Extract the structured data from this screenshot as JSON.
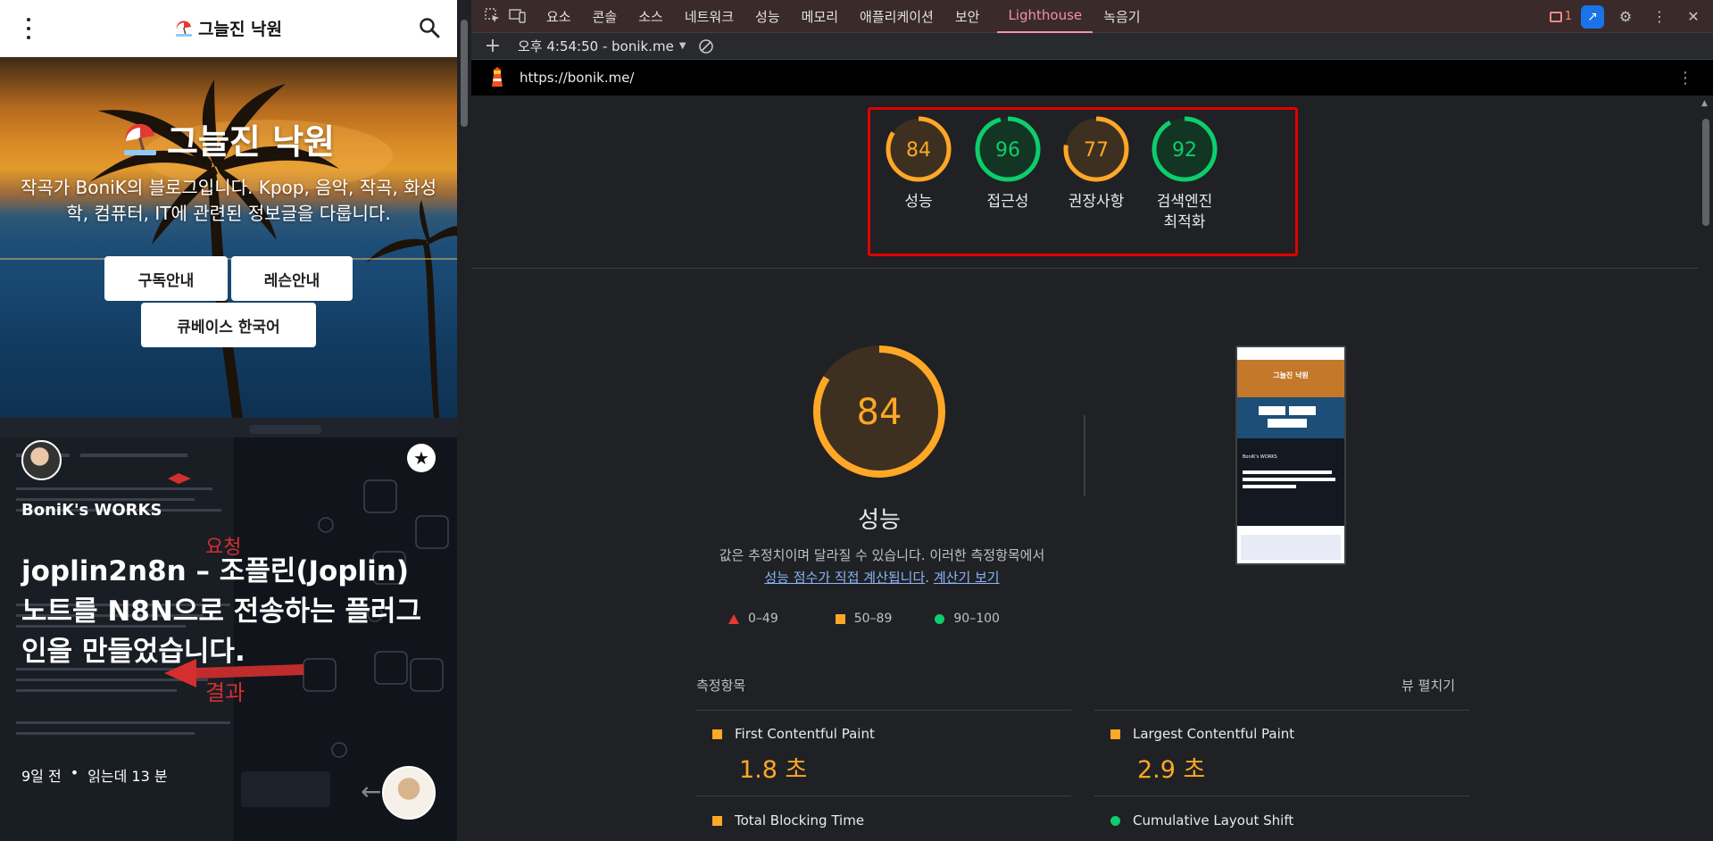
{
  "mobile": {
    "site_title": "그늘진 낙원",
    "hero_title": "그늘진 낙원",
    "hero_desc": "작곡가 BoniK의 블로그입니다. Kpop, 음악, 작곡, 화성학, 컴퓨터, IT에 관련된 정보글을 다룹니다.",
    "buttons": [
      "구독안내",
      "레슨안내",
      "큐베이스 한국어"
    ],
    "post": {
      "category": "BoniK's WORKS",
      "title": "joplin2n8n – 조플린(Joplin) 노트를 N8N으로 전송하는 플러그인을 만들었습니다.",
      "date": "9일 전",
      "separator": "•",
      "read_time": "읽는데 13 분",
      "overlay_words": [
        "요청",
        "결과"
      ]
    },
    "icons": [
      "menu-kebab-icon",
      "search-icon",
      "beach-umbrella-icon",
      "star-icon",
      "arrow-left-icon"
    ]
  },
  "devtools": {
    "tabs": [
      "요소",
      "콘솔",
      "소스",
      "네트워크",
      "성능",
      "메모리",
      "애플리케이션",
      "보안",
      "Lighthouse",
      "녹음기"
    ],
    "active_tab": "Lighthouse",
    "issues_count": "1",
    "report_selector": "오후 4:54:50 - bonik.me",
    "url": "https://bonik.me/",
    "accent": "#f48fb1"
  },
  "scores": [
    {
      "value": 84,
      "label": "성능",
      "color": "#ffa726",
      "bg": "#3d3020"
    },
    {
      "value": 96,
      "label": "접근성",
      "color": "#0cce6b",
      "bg": "#133524"
    },
    {
      "value": 77,
      "label": "권장사항",
      "color": "#ffa726",
      "bg": "#3d3020"
    },
    {
      "value": 92,
      "label": "검색엔진\n최적화",
      "color": "#0cce6b",
      "bg": "#133524"
    }
  ],
  "main_score": {
    "value": 84,
    "label": "성능"
  },
  "desc": {
    "text": "값은 추정치이며 달라질 수 있습니다. 이러한 측정항목에서",
    "link1": "성능 점수가 직접 계산됩니다",
    "dot": ".",
    "link2": "계산기 보기"
  },
  "legend": [
    {
      "range": "0–49",
      "shape": "triangle",
      "color": "#e53935"
    },
    {
      "range": "50–89",
      "shape": "square",
      "color": "#ffa726"
    },
    {
      "range": "90–100",
      "shape": "circle",
      "color": "#0cce6b"
    }
  ],
  "metrics_header": {
    "title": "측정항목",
    "expand": "뷰 펼치기"
  },
  "metrics": [
    {
      "name": "First Contentful Paint",
      "value": "1.8 초",
      "status": "average"
    },
    {
      "name": "Largest Contentful Paint",
      "value": "2.9 초",
      "status": "average"
    },
    {
      "name": "Total Blocking Time",
      "value": "",
      "status": "average"
    },
    {
      "name": "Cumulative Layout Shift",
      "value": "",
      "status": "pass"
    }
  ],
  "thumbnail": {
    "title": "그늘진 낙원",
    "post_category": "BoniK's WORKS",
    "post_title": "joplin2n8n – 조플린(Joplin) 노트를 N8N으로 전송하는 플러그인을 만들었습니다."
  }
}
